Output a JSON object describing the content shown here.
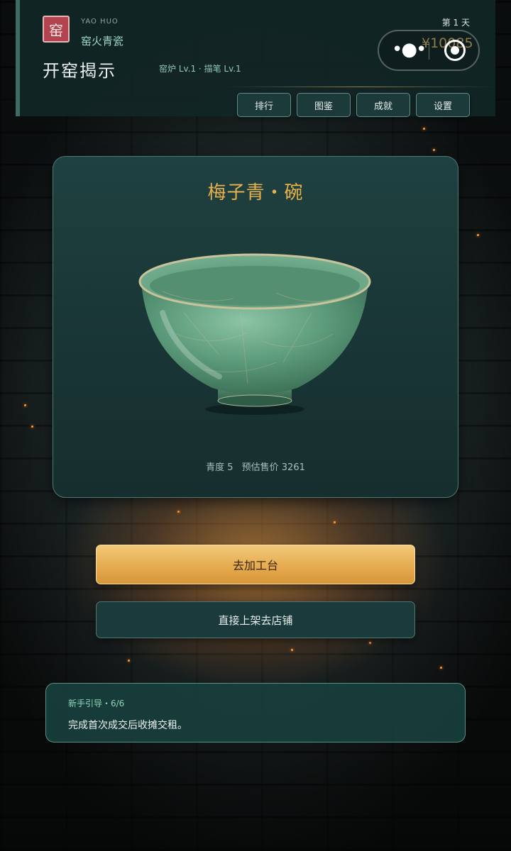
{
  "header": {
    "seal_char": "窑",
    "brand_en": "YAO HUO",
    "brand_cn": "窑火青瓷",
    "page_title": "开窑揭示",
    "levels": "窑炉 Lv.1 · 描笔 Lv.1",
    "day": "第 1 天",
    "money": "¥10085",
    "capsule": {
      "more_icon": "more-dots-icon",
      "close_icon": "target-close-icon"
    }
  },
  "nav": [
    {
      "label": "排行"
    },
    {
      "label": "图鉴"
    },
    {
      "label": "成就"
    },
    {
      "label": "设置"
    }
  ],
  "item": {
    "title": "梅子青・碗",
    "qingdu": "青度 5",
    "price": "预估售价 3261",
    "image": "celadon-bowl-illustration",
    "colors": {
      "glaze": "#4f8f6e",
      "accent": "#e9b14a"
    }
  },
  "actions": {
    "primary": "去加工台",
    "secondary": "直接上架去店铺"
  },
  "guide": {
    "title": "新手引导・6/6",
    "text": "完成首次成交后收摊交租。"
  }
}
